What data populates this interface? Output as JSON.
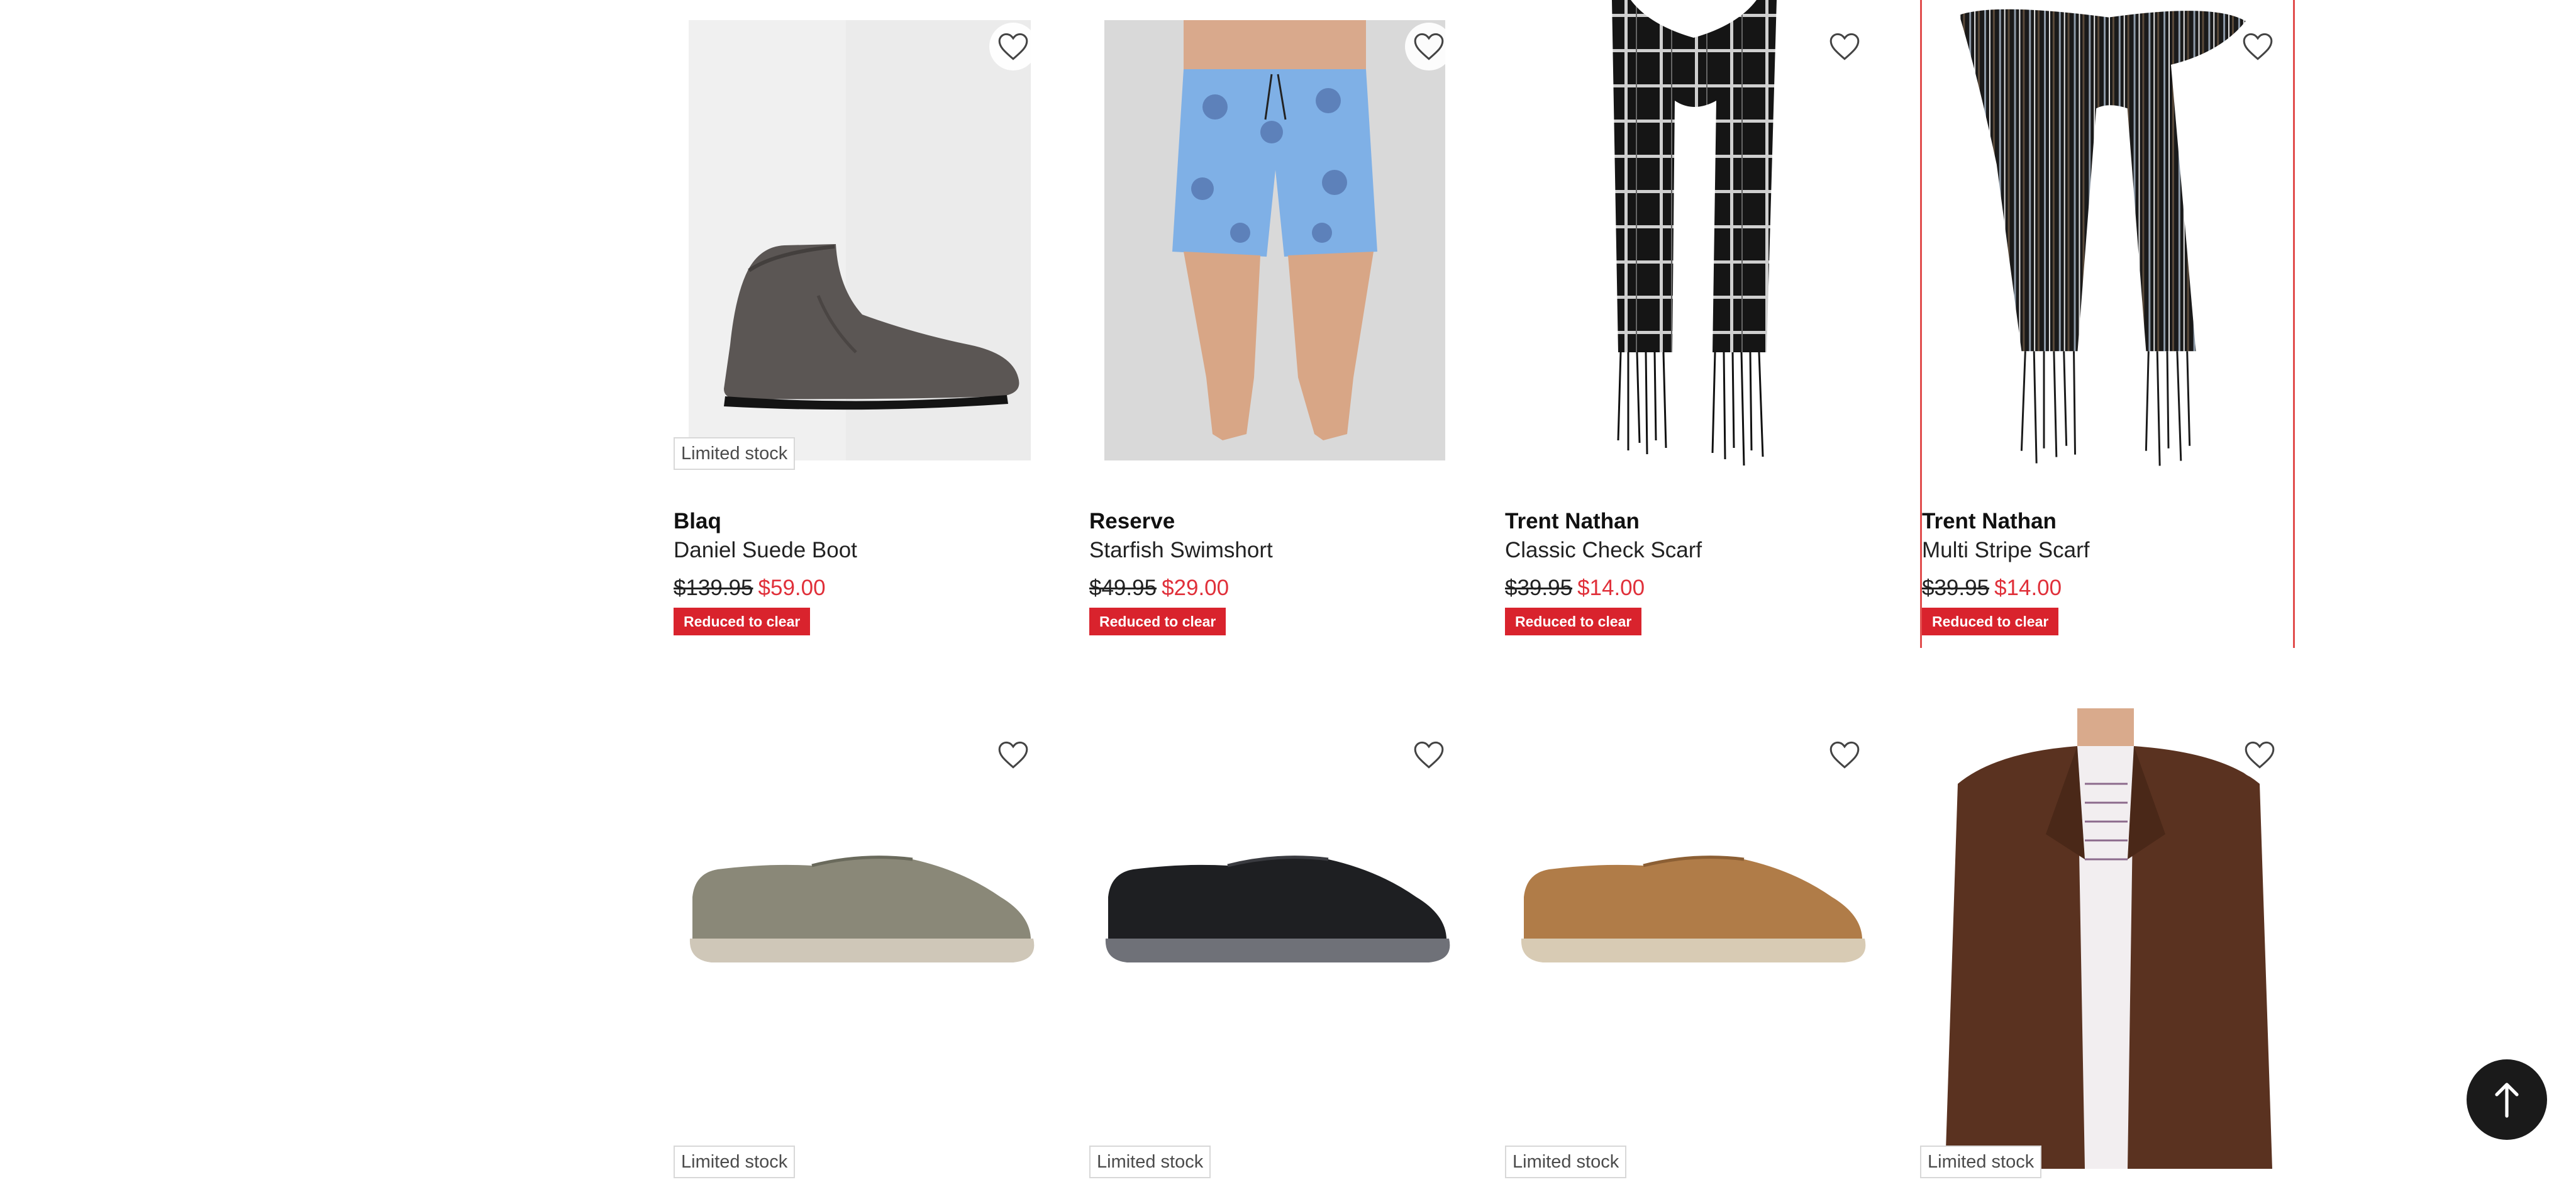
{
  "products": [
    {
      "brand": "Blaq",
      "name": "Daniel Suede Boot",
      "was": "$139.95",
      "now": "$59.00",
      "badge": "Limited stock",
      "tag": "Reduced to clear",
      "image": "grey-suede-chukka-boot"
    },
    {
      "brand": "Reserve",
      "name": "Starfish Swimshort",
      "was": "$49.95",
      "now": "$29.00",
      "tag": "Reduced to clear",
      "image": "blue-starfish-swimshorts"
    },
    {
      "brand": "Trent Nathan",
      "name": "Classic Check Scarf",
      "was": "$39.95",
      "now": "$14.00",
      "tag": "Reduced to clear",
      "image": "black-check-scarf"
    },
    {
      "brand": "Trent Nathan",
      "name": "Multi Stripe Scarf",
      "was": "$39.95",
      "now": "$14.00",
      "tag": "Reduced to clear",
      "image": "multi-stripe-scarf"
    },
    {
      "badge": "Limited stock",
      "image": "olive-casual-lace-up-shoe"
    },
    {
      "badge": "Limited stock",
      "image": "black-casual-lace-up-shoe"
    },
    {
      "badge": "Limited stock",
      "image": "tan-casual-lace-up-shoe"
    },
    {
      "badge": "Limited stock",
      "image": "brown-overshirt-jacket"
    }
  ],
  "icons": {
    "wishlist": "heart-outline-icon",
    "back_to_top": "arrow-up-icon"
  },
  "colors": {
    "sale": "#d9232d",
    "price_now": "#e0303a",
    "selected_outline": "#e14d4d"
  }
}
